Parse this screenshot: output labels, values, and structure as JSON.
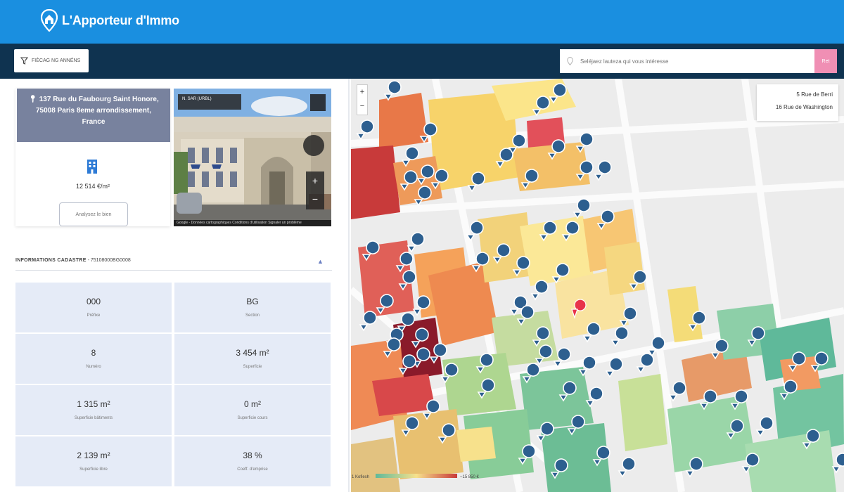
{
  "app": {
    "title": "L'Apporteur d'Immo"
  },
  "toolbar": {
    "filter_label": "FIÈCAG NG ANNÉNS",
    "search_placeholder": "Seléjaez lauteza qui vous intéresse",
    "search_button": "Ret"
  },
  "property": {
    "address": "137 Rue du Faubourg Saint Honore, 75008 Paris 8eme arrondissement, France",
    "price": "12 514 €/m²",
    "analyse_button": "Analysez le bien"
  },
  "streetview": {
    "label": "N. SAR (URBL)",
    "footer": "Google - Données cartographiques   Conditions d'utilisation   Signaler un problème"
  },
  "cadastre": {
    "title": "INFORMATIONS CADASTRE",
    "subtitle": "- 75108000BG0008",
    "cells": [
      {
        "value": "000",
        "label": "Préfixe"
      },
      {
        "value": "BG",
        "label": "Section"
      },
      {
        "value": "8",
        "label": "Numéro"
      },
      {
        "value": "3 454 m²",
        "label": "Superficie"
      },
      {
        "value": "1 315 m²",
        "label": "Superficie bâtiments"
      },
      {
        "value": "0 m²",
        "label": "Superficie cours"
      },
      {
        "value": "2 139 m²",
        "label": "Superficie libre"
      },
      {
        "value": "38 %",
        "label": "Coeff. d'emprise"
      }
    ]
  },
  "map": {
    "street_labels": [
      "5 Rue de Berri",
      "16 Rue de Washington"
    ],
    "legend_left": "1 Kofiesh",
    "legend_right": "~15 850 €",
    "active_marker_color": "#e8334a",
    "marker_color": "#2d5f8f"
  }
}
